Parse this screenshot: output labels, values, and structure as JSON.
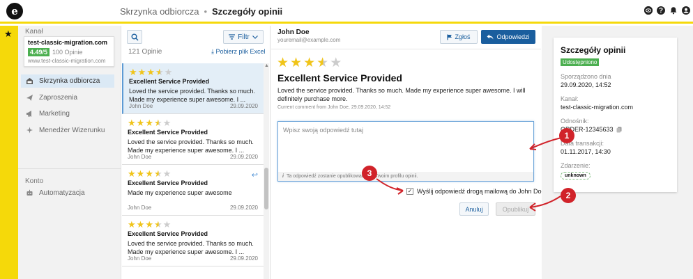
{
  "header": {
    "logo_letter": "e",
    "breadcrumb_parent": "Skrzynka odbiorcza",
    "breadcrumb_separator": "•",
    "breadcrumb_current": "Szczegóły opinii",
    "icons": [
      "eye-icon",
      "help-icon",
      "bell-icon",
      "user-icon"
    ]
  },
  "sidebar": {
    "channel_label": "Kanał",
    "channel": {
      "name": "test-classic-migration.com",
      "rating": "4.49/5",
      "opinions": "100 Opinie",
      "url": "www.test-classic-migration.com"
    },
    "items": [
      {
        "label": "Skrzynka odbiorcza",
        "icon": "inbox-icon",
        "active": true
      },
      {
        "label": "Zaproszenia",
        "icon": "send-icon"
      },
      {
        "label": "Marketing",
        "icon": "megaphone-icon"
      },
      {
        "label": "Menedżer Wizerunku",
        "icon": "sparkle-icon"
      }
    ],
    "account_label": "Konto",
    "account_items": [
      {
        "label": "Automatyzacja",
        "icon": "robot-icon"
      }
    ]
  },
  "list": {
    "filter_label": "Filtr",
    "count": "121 Opinie",
    "download_label": "Pobierz plik Excel",
    "reviews": [
      {
        "stars": 3.5,
        "title": "Excellent Service Provided",
        "body": "Loved the service provided. Thanks so much. Made my experience super awesome. I ...",
        "author": "John Doe",
        "date": "29.09.2020",
        "selected": true,
        "replied": false
      },
      {
        "stars": 3.5,
        "title": "Excellent Service Provided",
        "body": "Loved the service provided. Thanks so much. Made my experience super awesome. I ...",
        "author": "John Doe",
        "date": "29.09.2020",
        "selected": false,
        "replied": false
      },
      {
        "stars": 3.5,
        "title": "Excellent Service Provided",
        "body": "Made my experience super awesome",
        "author": "John Doe",
        "date": "29.09.2020",
        "selected": false,
        "replied": true
      },
      {
        "stars": 3.5,
        "title": "Excellent Service Provided",
        "body": "Loved the service provided. Thanks so much. Made my experience super awesome. I ...",
        "author": "John Doe",
        "date": "29.09.2020",
        "selected": false,
        "replied": false
      }
    ]
  },
  "detail": {
    "author_name": "John Doe",
    "author_email": "youremail@example.com",
    "report_label": "Zgłoś",
    "reply_label": "Odpowiedzi",
    "stars": 3.5,
    "title": "Excellent Service Provided",
    "text": "Loved the service provided. Thanks so much. Made my experience super awesome. I will definitely purchase more.",
    "meta": "Current comment from John Doe, 29.09.2020, 14:52",
    "reply_placeholder": "Wpisz swoją odpowiedź tutaj",
    "reply_info": "Ta odpowiedź zostanie opublikowana na Twoim profilu opinii.",
    "email_checkbox_label": "Wyślij odpowiedź drogą mailową do John Doe",
    "email_checkbox_checked": true,
    "cancel_label": "Anuluj",
    "publish_label": "Opublikuj"
  },
  "details_panel": {
    "title": "Szczegóły opinii",
    "status": "Udostępniono",
    "created_label": "Sporządzono dnia",
    "created_value": "29.09.2020, 14:52",
    "channel_label": "Kanał:",
    "channel_value": "test-classic-migration.com",
    "reference_label": "Odnośnik:",
    "reference_value": "ORDER-12345633",
    "transaction_label": "Data transakcji:",
    "transaction_value": "01.11.2017, 14:30",
    "event_label": "Zdarzenie:",
    "event_value": "unknown"
  },
  "annotations": {
    "badges": [
      "1",
      "2",
      "3"
    ],
    "color": "#d1232a"
  },
  "colors": {
    "accent_yellow": "#f5d90a",
    "primary_blue": "#1a5e9e",
    "rating_green": "#4caf50",
    "star_gold": "#f0c419"
  }
}
